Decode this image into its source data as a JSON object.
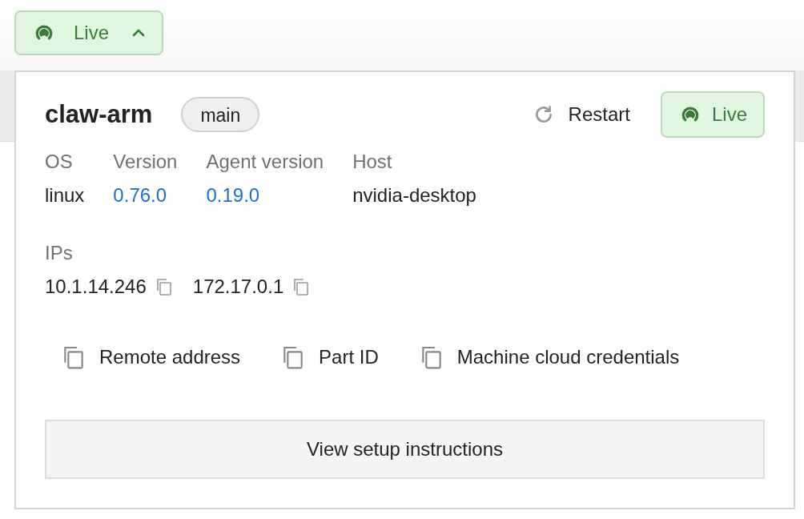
{
  "status_button": {
    "label": "Live",
    "expanded": true
  },
  "popover": {
    "title": "claw-arm",
    "branch": "main",
    "restart": "Restart",
    "live_button": "Live",
    "details": [
      {
        "label": "OS",
        "value": "linux",
        "kind": "text"
      },
      {
        "label": "Version",
        "value": "0.76.0",
        "kind": "link"
      },
      {
        "label": "Agent version",
        "value": "0.19.0",
        "kind": "link"
      },
      {
        "label": "Host",
        "value": "nvidia-desktop",
        "kind": "text"
      }
    ],
    "ips": {
      "label": "IPs",
      "items": [
        "10.1.14.246",
        "172.17.0.1"
      ]
    },
    "copy_actions": [
      "Remote address",
      "Part ID",
      "Machine cloud credentials"
    ],
    "setup_button": "View setup instructions"
  }
}
